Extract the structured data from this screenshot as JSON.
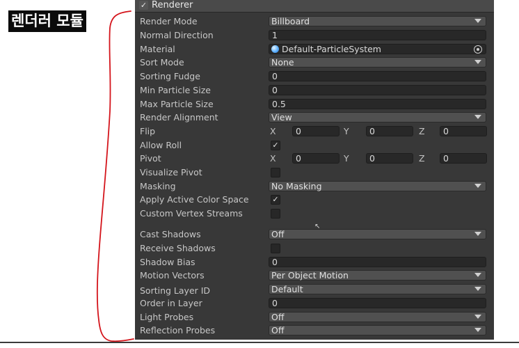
{
  "annotation": {
    "title": "렌더러 모듈",
    "bracket_color": "#d4141b"
  },
  "header": {
    "title": "Renderer",
    "checked": "✓"
  },
  "rows": {
    "render_mode": {
      "label": "Render Mode",
      "value": "Billboard"
    },
    "normal_direction": {
      "label": "Normal Direction",
      "value": "1"
    },
    "material": {
      "label": "Material",
      "value": "Default-ParticleSystem"
    },
    "sort_mode": {
      "label": "Sort Mode",
      "value": "None"
    },
    "sorting_fudge": {
      "label": "Sorting Fudge",
      "value": "0"
    },
    "min_particle_size": {
      "label": "Min Particle Size",
      "value": "0"
    },
    "max_particle_size": {
      "label": "Max Particle Size",
      "value": "0.5"
    },
    "render_alignment": {
      "label": "Render Alignment",
      "value": "View"
    },
    "flip": {
      "label": "Flip",
      "x_label": "X",
      "x": "0",
      "y_label": "Y",
      "y": "0",
      "z_label": "Z",
      "z": "0"
    },
    "allow_roll": {
      "label": "Allow Roll",
      "checked": "✓"
    },
    "pivot": {
      "label": "Pivot",
      "x_label": "X",
      "x": "0",
      "y_label": "Y",
      "y": "0",
      "z_label": "Z",
      "z": "0"
    },
    "visualize_pivot": {
      "label": "Visualize Pivot",
      "checked": ""
    },
    "masking": {
      "label": "Masking",
      "value": "No Masking"
    },
    "apply_active_color_space": {
      "label": "Apply Active Color Space",
      "checked": "✓"
    },
    "custom_vertex_streams": {
      "label": "Custom Vertex Streams",
      "checked": ""
    },
    "cast_shadows": {
      "label": "Cast Shadows",
      "value": "Off"
    },
    "receive_shadows": {
      "label": "Receive Shadows",
      "checked": ""
    },
    "shadow_bias": {
      "label": "Shadow Bias",
      "value": "0"
    },
    "motion_vectors": {
      "label": "Motion Vectors",
      "value": "Per Object Motion"
    },
    "sorting_layer_id": {
      "label": "Sorting Layer ID",
      "value": "Default"
    },
    "order_in_layer": {
      "label": "Order in Layer",
      "value": "0"
    },
    "light_probes": {
      "label": "Light Probes",
      "value": "Off"
    },
    "reflection_probes": {
      "label": "Reflection Probes",
      "value": "Off"
    }
  },
  "colors": {
    "panel_bg": "#383838",
    "label": "#c7c7c7",
    "field_bg": "#282828",
    "dropdown_bg": "#505050"
  }
}
